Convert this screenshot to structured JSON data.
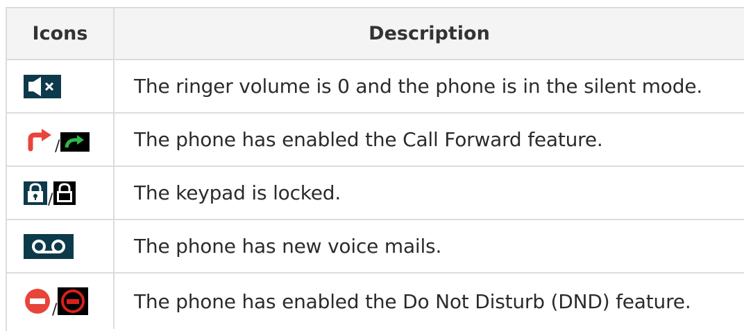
{
  "table": {
    "headers": {
      "icons": "Icons",
      "description": "Description"
    },
    "rows": [
      {
        "icons": [
          "muted-speaker-icon"
        ],
        "description": "The ringer volume is 0 and the phone is in the silent mode."
      },
      {
        "icons": [
          "call-forward-arrow-icon",
          "call-forward-green-arrow-icon"
        ],
        "separator": "/",
        "description": "The phone has enabled the Call Forward feature."
      },
      {
        "icons": [
          "padlock-filled-icon",
          "padlock-outline-icon"
        ],
        "separator": "/",
        "description": "The keypad is locked."
      },
      {
        "icons": [
          "voicemail-icon"
        ],
        "description": "The phone has new voice mails."
      },
      {
        "icons": [
          "do-not-disturb-icon",
          "do-not-disturb-black-box-icon"
        ],
        "separator": "/",
        "description": "The phone has enabled the Do Not Disturb (DND) feature."
      }
    ]
  },
  "colors": {
    "icon_dark_teal": "#0d3a4a",
    "forward_red": "#e8443a",
    "forward_green": "#2fb84a",
    "dnd_red": "#e8443a",
    "dnd_box_red": "#d8201a",
    "border": "#dcdcdc",
    "header_bg": "#f4f4f4"
  }
}
